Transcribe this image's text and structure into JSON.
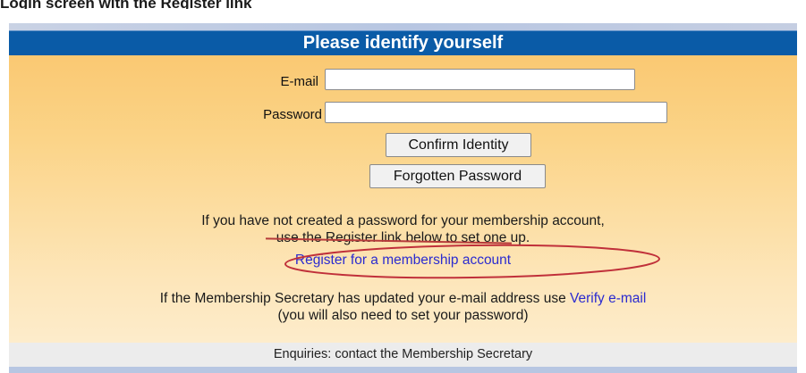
{
  "caption": "Login screen with the Register link",
  "form": {
    "title": "Please identify yourself",
    "email_label": "E-mail",
    "email_value": "",
    "password_label": "Password",
    "password_value": "",
    "confirm_button": "Confirm Identity",
    "forgotten_button": "Forgotten Password"
  },
  "info": {
    "line1": "If you have not created a password for your membership account,",
    "line2": "use the Register link below to set one up.",
    "register_link": "Register for a membership account",
    "verify_prefix": "If the Membership Secretary has updated your e-mail address use ",
    "verify_link": "Verify e-mail",
    "verify_note": "(you will also need to set your password)"
  },
  "footer": {
    "text": "Enquiries: contact the Membership Secretary"
  },
  "colors": {
    "banner": "#0a5ba7",
    "link": "#2b2bd0",
    "highlight_oval": "#c0303a"
  }
}
